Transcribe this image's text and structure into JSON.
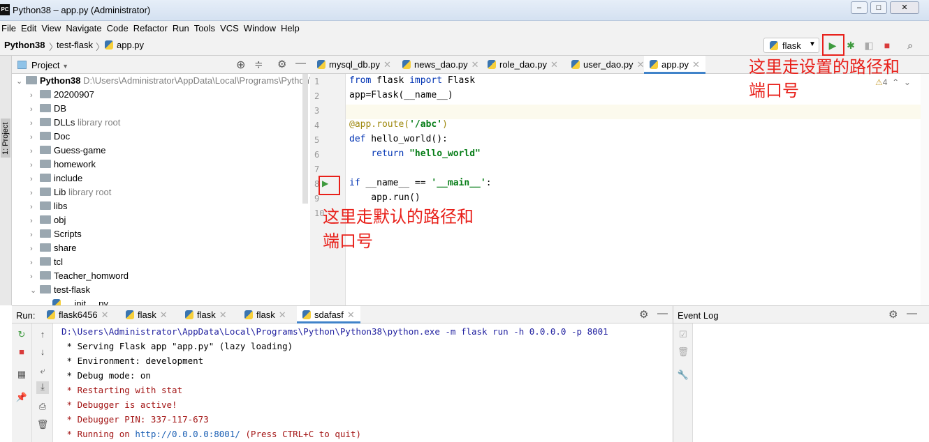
{
  "window": {
    "title": "Python38 – app.py (Administrator)",
    "logo": "PC",
    "controls": [
      "minimize",
      "maximize",
      "close"
    ]
  },
  "menu": [
    "File",
    "Edit",
    "View",
    "Navigate",
    "Code",
    "Refactor",
    "Run",
    "Tools",
    "VCS",
    "Window",
    "Help"
  ],
  "breadcrumb": [
    "Python38",
    "test-flask",
    "app.py"
  ],
  "toolbar": {
    "run_config": "flask",
    "icons": [
      "run-icon",
      "debug-icon",
      "coverage-icon",
      "stop-icon",
      "search-icon"
    ]
  },
  "side_stripe": {
    "label": "1: Project"
  },
  "project": {
    "title": "Project",
    "root": {
      "name": "Python38",
      "path": "D:\\Users\\Administrator\\AppData\\Local\\Programs\\Python\\Python38"
    },
    "items": [
      {
        "name": "20200907",
        "note": ""
      },
      {
        "name": "DB",
        "note": ""
      },
      {
        "name": "DLLs",
        "note": "library root"
      },
      {
        "name": "Doc",
        "note": ""
      },
      {
        "name": "Guess-game",
        "note": ""
      },
      {
        "name": "homework",
        "note": ""
      },
      {
        "name": "include",
        "note": ""
      },
      {
        "name": "Lib",
        "note": "library root"
      },
      {
        "name": "libs",
        "note": ""
      },
      {
        "name": "obj",
        "note": ""
      },
      {
        "name": "Scripts",
        "note": ""
      },
      {
        "name": "share",
        "note": ""
      },
      {
        "name": "tcl",
        "note": ""
      },
      {
        "name": "Teacher_homword",
        "note": ""
      },
      {
        "name": "test-flask",
        "note": ""
      },
      {
        "name": "__init__.py",
        "note": ""
      }
    ]
  },
  "editor": {
    "tabs": [
      "mysql_db.py",
      "news_dao.py",
      "role_dao.py",
      "user_dao.py",
      "app.py"
    ],
    "active_tab": "app.py",
    "warnings": "4",
    "lines": [
      "1",
      "2",
      "3",
      "4",
      "5",
      "6",
      "7",
      "8",
      "9",
      "10"
    ]
  },
  "annotations": {
    "top": [
      "这里走设置的路径和",
      "端口号"
    ],
    "gutter": [
      "这里走默认的路径和",
      "端口号"
    ],
    "color": "#e8201a"
  },
  "run": {
    "label": "Run:",
    "tabs": [
      "flask6456",
      "flask",
      "flask",
      "flask",
      "sdafasf"
    ],
    "active_tab": "sdafasf",
    "console": {
      "command": "D:\\Users\\Administrator\\AppData\\Local\\Programs\\Python\\Python38\\python.exe -m flask run -h 0.0.0.0 -p 8001",
      "info": [
        " * Serving Flask app \"app.py\" (lazy loading)",
        " * Environment: development",
        " * Debug mode: on"
      ],
      "errors": [
        " * Restarting with stat",
        " * Debugger is active!",
        " * Debugger PIN: 337-117-673"
      ],
      "running_prefix": " * Running on ",
      "url": "http://0.0.0.0:8001/",
      "running_suffix": " (Press CTRL+C to quit)"
    }
  },
  "event_log": {
    "title": "Event Log"
  }
}
